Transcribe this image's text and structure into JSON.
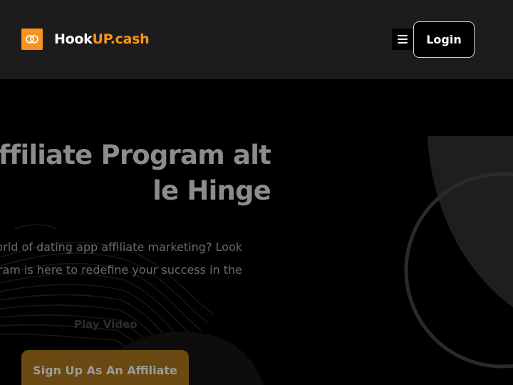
{
  "header": {
    "brand_part1": "Hook",
    "brand_part2": "UP.cash",
    "logo_icon": "linked-rings-icon",
    "menu_icon": "hamburger-menu-icon",
    "login_label": "Login"
  },
  "hero": {
    "headline_lines": [
      "ffiliate Program alt",
      "le Hinge"
    ],
    "paragraph_lines": [
      "world of dating app affiliate marketing? Look",
      "ram is here to redefine your success in the"
    ],
    "play_video_label": "Play Video",
    "signup_label": "Sign Up As An Affiliate"
  },
  "colors": {
    "accent": "#f7941d",
    "header_bg": "#1c1c1c",
    "page_bg": "#000000",
    "headline": "#8c8c8c"
  }
}
